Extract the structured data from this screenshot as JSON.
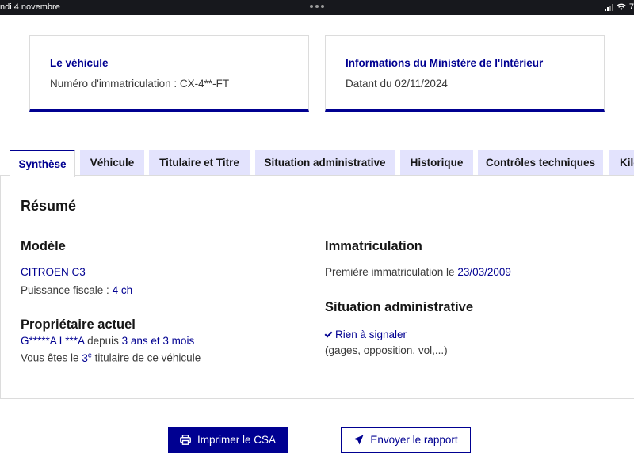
{
  "status_bar": {
    "date": "ndi 4 novembre",
    "right_text": "7"
  },
  "cards": {
    "vehicle": {
      "title": "Le véhicule",
      "text": "Numéro d'immatriculation : CX-4**-FT"
    },
    "ministry": {
      "title": "Informations du Ministère de l'Intérieur",
      "text": "Datant du 02/11/2024"
    }
  },
  "tabs": [
    {
      "label": "Synthèse",
      "active": true
    },
    {
      "label": "Véhicule",
      "active": false
    },
    {
      "label": "Titulaire et Titre",
      "active": false
    },
    {
      "label": "Situation administrative",
      "active": false
    },
    {
      "label": "Historique",
      "active": false
    },
    {
      "label": "Contrôles techniques",
      "active": false
    },
    {
      "label": "Kilo",
      "active": false
    }
  ],
  "summary": {
    "title": "Résumé",
    "model": {
      "heading": "Modèle",
      "name": "CITROEN C3",
      "power_label": "Puissance fiscale :",
      "power_value": "4 ch"
    },
    "owner": {
      "heading": "Propriétaire actuel",
      "name": "G*****A L***A",
      "since_label": "depuis",
      "since_value": "3 ans et 3 mois",
      "rank_prefix": "Vous êtes le",
      "rank_number": "3",
      "rank_suffix": "e",
      "rank_tail": "titulaire de ce véhicule"
    },
    "registration": {
      "heading": "Immatriculation",
      "first_label": "Première immatriculation le",
      "first_date": "23/03/2009"
    },
    "admin": {
      "heading": "Situation administrative",
      "status": "Rien à signaler",
      "details": "(gages, opposition, vol,...)"
    }
  },
  "actions": {
    "print_label": "Imprimer le CSA",
    "send_label": "Envoyer le rapport"
  },
  "colors": {
    "primary": "#000091",
    "tab_bg": "#e3e3fd",
    "border": "#dcdcdc",
    "status_bar": "#17181d"
  }
}
